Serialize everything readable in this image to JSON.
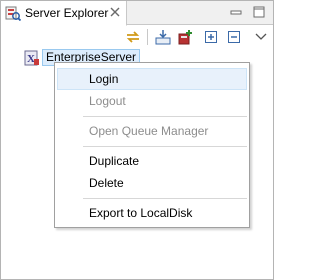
{
  "view": {
    "tab_title": "Server Explorer"
  },
  "tree": {
    "nodes": [
      {
        "label": "EnterpriseServer",
        "selected": true
      }
    ]
  },
  "context_menu": {
    "items": [
      {
        "label": "Login",
        "enabled": true,
        "highlighted": true
      },
      {
        "label": "Logout",
        "enabled": false
      },
      {
        "label": "Open Queue Manager",
        "enabled": false
      },
      {
        "label": "Duplicate",
        "enabled": true
      },
      {
        "label": "Delete",
        "enabled": true
      },
      {
        "label": "Export to LocalDisk",
        "enabled": true
      }
    ]
  },
  "icons": {
    "tab": "server-explorer-icon",
    "tab_close": "close-icon",
    "minimize": "minimize-icon",
    "maximize": "maximize-icon",
    "toolbar": [
      "sync-icon",
      "import-icon",
      "new-connection-icon",
      "expand-all-icon",
      "collapse-all-icon",
      "view-menu-icon"
    ],
    "node": "enterprise-server-icon"
  },
  "colors": {
    "selection_fill": "#dcecfc",
    "selection_border": "#99c9ef",
    "menu_hover": "#e8f1fb",
    "disabled_text": "#8d8d8d"
  }
}
